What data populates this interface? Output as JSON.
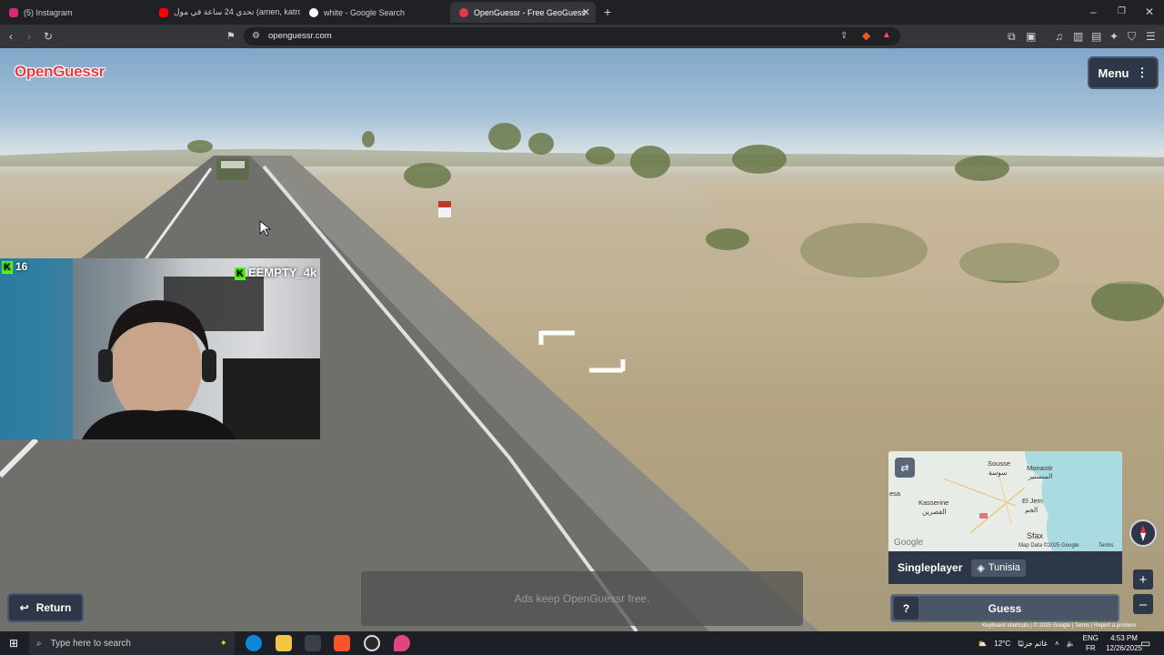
{
  "browser": {
    "tabs": [
      {
        "label": "(5) Instagram",
        "color": "#d62976"
      },
      {
        "label": "تحدي 24 ساعة في مول (amen, katrou",
        "color": "#ff0000"
      },
      {
        "label": "white - Google Search",
        "color": "#4285f4"
      },
      {
        "label": "OpenGuessr - Free GeoGuess",
        "color": "#e63946",
        "active": true
      }
    ],
    "url": "openguessr.com"
  },
  "game": {
    "logo": "OpenGuessr",
    "menu_label": "Menu",
    "stream": {
      "viewer_count": "16",
      "username": "EEMPTY_4k"
    },
    "ad_text": "Ads keep OpenGuessr free.",
    "return_label": "Return",
    "mode_label": "Singleplayer",
    "country_label": "Tunisia",
    "help_label": "?",
    "guess_label": "Guess",
    "map_labels": {
      "sousse": "Sousse",
      "sousse_ar": "سوسة",
      "monastir": "Monastir",
      "monastir_ar": "المنستير",
      "kasserine": "Kasserine",
      "kasserine_ar": "القصرين",
      "eljem": "El Jem",
      "eljem_ar": "الجم",
      "sfax": "Sfax",
      "bessa": "esa",
      "google": "Google",
      "mapdata": "Map Data ©2025 Google",
      "terms": "Terms"
    },
    "footer": "Keyboard shortcuts  |  © 2025 Google  |  Terms  |  Report a problem"
  },
  "taskbar": {
    "search_placeholder": "Type here to search",
    "weather": "12°C",
    "weather_text": "غائم جزئيًا",
    "lang_top": "ENG",
    "lang_bottom": "FR",
    "time": "4:53 PM",
    "date": "12/26/2025"
  },
  "colors": {
    "brand": "#e63946",
    "panel": "#2d3748",
    "kick": "#53fc18"
  }
}
